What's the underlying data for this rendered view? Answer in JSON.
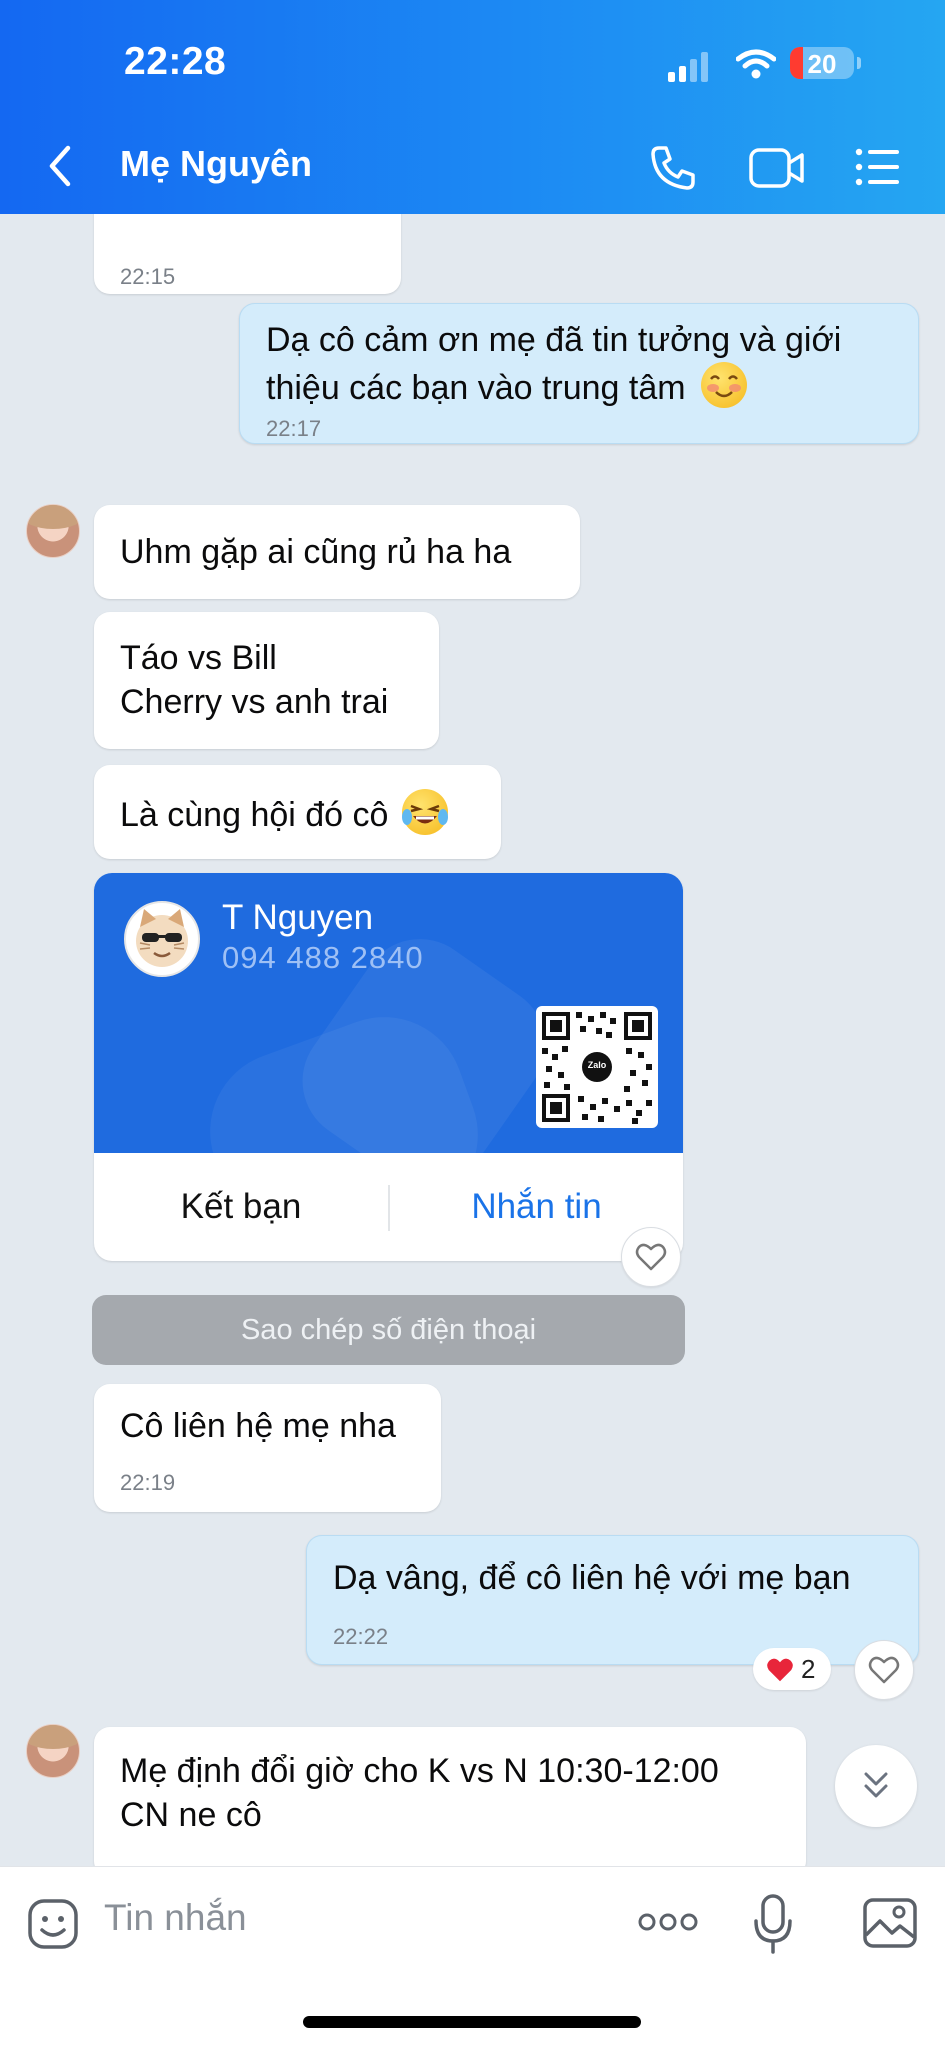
{
  "status_bar": {
    "time": "22:28",
    "battery": "20",
    "battery_level": 0.2
  },
  "header": {
    "title": "Mẹ Nguyên",
    "icons": [
      "back-chevron-icon",
      "phone-call-icon",
      "video-call-icon",
      "menu-list-icon"
    ]
  },
  "messages": [
    {
      "dir": "in",
      "lines": [
        "Dạ cô cảm ơn mẹ đã tin tưởng và giới",
        "thiệu các bạn vào trung tâm"
      ],
      "time": "22:17"
    },
    {
      "dir": "in",
      "lines": [
        "Uhm gặp ai cũng rủ ha ha"
      ]
    },
    {
      "dir": "in",
      "lines": [
        "Táo vs Bill",
        "Cherry vs anh trai"
      ]
    },
    {
      "dir": "in",
      "lines": [
        "Là cùng hội đó cô"
      ]
    },
    {
      "dir": "in",
      "lines": [
        "Cô liên hệ mẹ nha"
      ],
      "time": "22:19"
    },
    {
      "dir": "out",
      "lines": [
        "Dạ vâng, để cô liên hệ với mẹ bạn"
      ],
      "time": "22:22"
    },
    {
      "dir": "in",
      "lines": [
        "Mẹ định đổi giờ cho K vs N 10:30-12:00",
        "CN ne cô"
      ]
    }
  ],
  "prev_time": "22:15",
  "contact_card": {
    "name": "T Nguyen",
    "phone": "094 488 2840",
    "qr_label": "Zalo",
    "add_friend_label": "Kết bạn",
    "message_label": "Nhắn tin"
  },
  "copy_phone_label": "Sao chép số điện thoại",
  "reaction": {
    "icon": "red-heart-icon",
    "count": "2"
  },
  "composer": {
    "placeholder": "Tin nhắn",
    "more_label": "ooo"
  },
  "colors": {
    "header_start": "#1468f2",
    "header_end": "#25a6f2",
    "card_blue": "#1f6bdf",
    "outgoing_bubble": "#d4ecfb",
    "chat_background": "#e3e9ef",
    "link_blue": "#1a73e8"
  }
}
